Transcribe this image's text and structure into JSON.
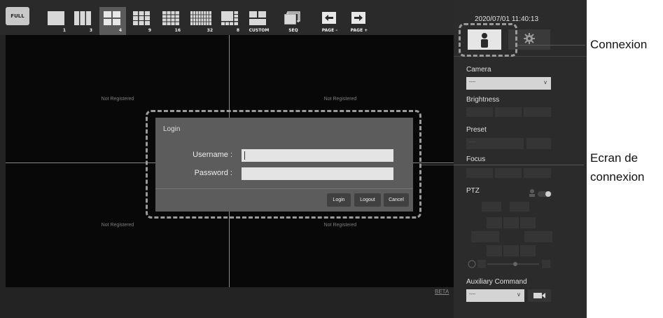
{
  "toolbar": {
    "full_label": "FULL",
    "layouts": [
      {
        "label": "1"
      },
      {
        "label": "3"
      },
      {
        "label": "4"
      },
      {
        "label": "9"
      },
      {
        "label": "16"
      },
      {
        "label": "32"
      },
      {
        "label": "8"
      },
      {
        "label": "CUSTOM"
      }
    ],
    "seq_label": "SEQ",
    "page_prev_label": "PAGE –",
    "page_next_label": "PAGE +"
  },
  "grid": {
    "cells": [
      "Not Registered",
      "Not Registered",
      "Not Registered",
      "Not Registered"
    ],
    "beta_label": "BETA"
  },
  "panel": {
    "datetime": "2020/07/01 11:40:13",
    "camera_label": "Camera",
    "camera_value": "----",
    "brightness_label": "Brightness",
    "preset_label": "Preset",
    "preset_value": "----",
    "focus_label": "Focus",
    "ptz_label": "PTZ",
    "aux_label": "Auxiliary Command",
    "aux_value": "----"
  },
  "login": {
    "title": "Login",
    "username_label": "Username :",
    "password_label": "Password :",
    "login_button": "Login",
    "logout_button": "Logout",
    "cancel_button": "Cancel"
  },
  "annotations": {
    "connexion": "Connexion",
    "ecran_line1": "Ecran de",
    "ecran_line2": "connexion"
  }
}
